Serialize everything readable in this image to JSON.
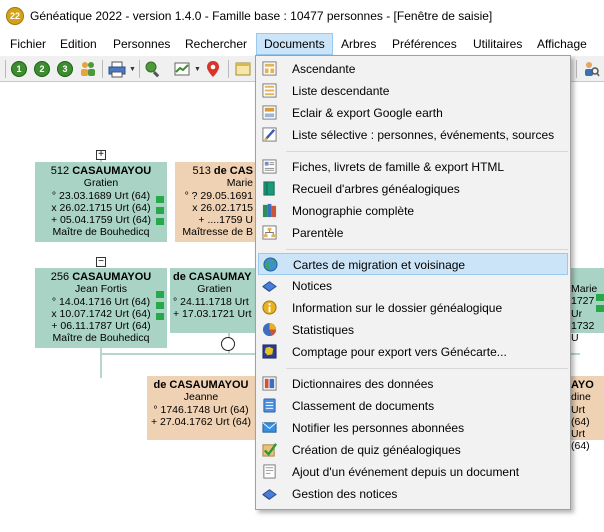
{
  "window": {
    "app_icon_text": "22",
    "title": "Généatique 2022 - version 1.4.0 - Famille base : 10477 personnes - [Fenêtre de saisie]"
  },
  "menubar": [
    {
      "label": "Fichier"
    },
    {
      "label": "Edition"
    },
    {
      "label": "Personnes"
    },
    {
      "label": "Rechercher"
    },
    {
      "label": "Documents"
    },
    {
      "label": "Arbres"
    },
    {
      "label": "Préférences"
    },
    {
      "label": "Utilitaires"
    },
    {
      "label": "Affichage"
    }
  ],
  "toolbar": {
    "buttons": [
      {
        "icon": "level-1-icon",
        "text": "1"
      },
      {
        "icon": "level-2-icon",
        "text": "2"
      },
      {
        "icon": "level-3-icon",
        "text": "3"
      }
    ]
  },
  "tree": {
    "expand_symbol": "+",
    "collapse_symbol": "−",
    "persons": [
      {
        "id": "p512",
        "num": "512",
        "surname": "CASAUMAYOU",
        "given": "Gratien",
        "lines": [
          "° 23.03.1689 Urt (64)",
          "x 26.02.1715 Urt (64)",
          "+ 05.04.1759 Urt (64)",
          "Maître de Bouhedicq"
        ]
      },
      {
        "id": "p513",
        "num": "513",
        "surname": "de CAS",
        "given": "Marie",
        "lines": [
          "° ? 29.05.1691",
          "x 26.02.1715",
          "+ ....1759 U",
          "Maîtresse de B"
        ]
      },
      {
        "id": "p256",
        "num": "256",
        "surname": "CASAUMAYOU",
        "given": "Jean Fortis",
        "lines": [
          "° 14.04.1716 Urt (64)",
          "x 10.07.1742 Urt (64)",
          "+ 06.11.1787 Urt (64)",
          "Maître de Bouhedicq"
        ]
      },
      {
        "id": "pmid",
        "num": "",
        "surname": "de CASAUMAY",
        "given": "Gratien",
        "lines": [
          "° 24.11.1718 Urt",
          "+ 17.03.1721 Urt"
        ]
      },
      {
        "id": "pjeanne",
        "num": "",
        "surname": "de CASAUMAYOU",
        "given": "Jeanne",
        "lines": [
          "° 1746.1748 Urt (64)",
          "+ 27.04.1762 Urt (64)"
        ]
      },
      {
        "id": "pright1",
        "num": "",
        "surname": "",
        "given": "Marie",
        "lines": [
          "1727 Ur",
          "1732 U"
        ]
      },
      {
        "id": "pright2",
        "num": "",
        "surname": "AYO",
        "given": "dine",
        "lines": [
          "Urt (64)",
          "Urt (64)"
        ]
      }
    ]
  },
  "documents_menu": {
    "items": [
      {
        "label": "Ascendante",
        "icon": "ascendante-icon"
      },
      {
        "label": "Liste descendante",
        "icon": "liste-descendante-icon"
      },
      {
        "label": "Eclair & export Google earth",
        "icon": "eclair-icon"
      },
      {
        "label": "Liste sélective : personnes, événements, sources",
        "icon": "liste-selective-icon"
      },
      {
        "label": "Fiches, livrets de famille & export HTML",
        "icon": "fiches-icon"
      },
      {
        "label": "Recueil d'arbres généalogiques",
        "icon": "recueil-icon"
      },
      {
        "label": "Monographie complète",
        "icon": "monographie-icon"
      },
      {
        "label": "Parentèle",
        "icon": "parentele-icon"
      },
      {
        "label": "Cartes de migration et voisinage",
        "icon": "globe-icon"
      },
      {
        "label": "Notices",
        "icon": "notices-icon"
      },
      {
        "label": "Information sur le dossier généalogique",
        "icon": "info-icon"
      },
      {
        "label": "Statistiques",
        "icon": "statistiques-icon"
      },
      {
        "label": "Comptage pour export vers Génécarte...",
        "icon": "comptage-icon"
      },
      {
        "label": "Dictionnaires des données",
        "icon": "dictionnaires-icon"
      },
      {
        "label": "Classement de documents",
        "icon": "classement-icon"
      },
      {
        "label": "Notifier les personnes abonnées",
        "icon": "notifier-icon"
      },
      {
        "label": "Création de quiz généalogiques",
        "icon": "quiz-icon"
      },
      {
        "label": "Ajout d'un événement depuis un document",
        "icon": "ajout-evenement-icon"
      },
      {
        "label": "Gestion des notices",
        "icon": "gestion-notices-icon"
      }
    ]
  }
}
